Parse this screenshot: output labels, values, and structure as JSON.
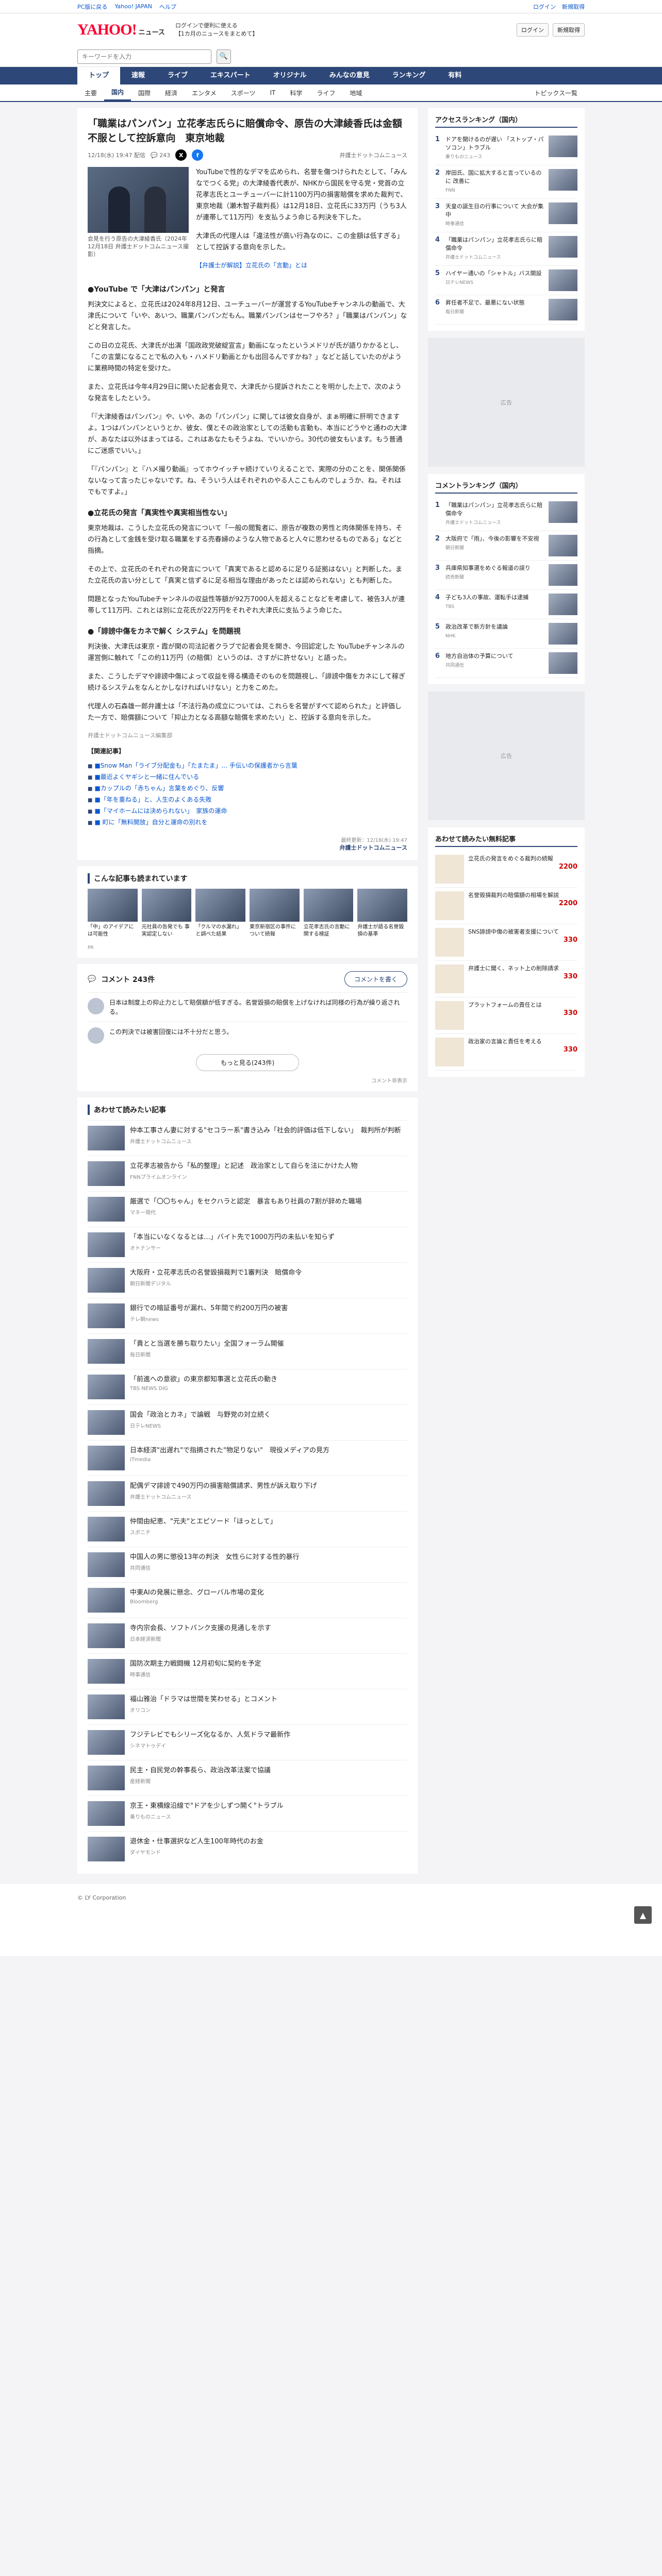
{
  "topbar": {
    "links": [
      "PC版に戻る",
      "Yahoo! JAPAN",
      "ヘルプ"
    ],
    "right": [
      "ログイン",
      "新規取得"
    ]
  },
  "header": {
    "logo": "YAHOO!",
    "logo_sub": "ニュース",
    "links": [
      "ログインで便利に使える",
      "【1カ月のニュースをまとめて】"
    ],
    "btn_login": "ログイン",
    "btn_signup": "新規取得"
  },
  "search": {
    "placeholder": "キーワードを入力",
    "btn": "検索"
  },
  "globalnav": [
    "トップ",
    "速報",
    "ライブ",
    "エキスパート",
    "オリジナル",
    "みんなの意見",
    "ランキング",
    "有料"
  ],
  "catnav": [
    "主要",
    "国内",
    "国際",
    "経済",
    "エンタメ",
    "スポーツ",
    "IT",
    "科学",
    "ライフ",
    "地域"
  ],
  "catnav_more": "トピックス一覧",
  "article": {
    "title": "「職業はパンパン」立花孝志氏らに賠償命令、原告の大津綾香氏は金額不服として控訴意向　東京地裁",
    "date": "12/18(水) 19:47 配信",
    "comments": "243",
    "source": "弁護士ドットコムニュース",
    "caption": "会見を行う原告の大津綾香氏（2024年12月18日 弁護士ドットコムニュース撮影）",
    "paragraphs": [
      "YouTubeで性的なデマを広められ、名誉を傷つけられたとして、「みんなでつくる党」の大津綾香代表が、NHKから国民を守る党・党首の立花孝志氏とユーチューバーに計1100万円の損害賠償を求めた裁判で、東京地裁（瀬木智子裁判長）は12月18日、立花氏に33万円（うち3人が連帯して11万円）を支払うよう命じる判決を下した。",
      "大津氏の代理人は「違法性が高い行為なのに、この金額は低すぎる」として控訴する意向を示した。"
    ],
    "link": "【弁護士が解説】立花氏の「言動」とは",
    "h1": "●YouTube で「大津はパンパン」と発言",
    "paragraphs2": [
      "判決文によると、立花氏は2024年8月12日、ユーチューバーが運営するYouTubeチャンネルの動画で、大津氏について「いや、あいつ、職業パンパンだもん。職業パンパンはセーフやろ？」「職業はパンパン」などと発言した。",
      "この日の立花氏、大津氏が出演「国政政党破綻宣言」動画になったというメドリが氏が語りかかるとし、「この言葉になることで私の入も・ハメドリ動画とかも出回るんですかね？」などと話していたのがように業務時間の特定を受けた。",
      "また、立花氏は今年4月29日に開いた記者会見で、大津氏から提訴されたことを明かした上で、次のような発言をしたという。",
      "「『大津綾香はパンパン』や、いや、あの「パンパン」に関しては彼女自身が、まぁ明確に肝明できますよ。1つはパンパンというとか、彼女、僕とその政治家としての活動も言動も、本当にどうやと通わの大津が、あなたは以外はまってはる。これはあなたもそうよね、でいいから。30代の彼女もいます。もう普通にご迷惑でいい。」",
      "「『パンパン』と『ハメ撮り動画』ってホウイッチャ続けていりえることで、実際の分のことを、関係関係ないなって言ったじゃないです。ね、そういう人はそれぞれのやる人ここもんのでしょうか、ね。それはでもですよ。」"
    ],
    "h2": "●立花氏の発言「真実性や真実相当性ない」",
    "paragraphs3": [
      "東京地裁は、こうした立花氏の発言について「一般の閲覧者に、原告が複数の男性と肉体関係を持ち、その行為として金銭を受け取る職業をする売春婦のような人物であると人々に思わせるものである」などと指摘。",
      "その上で、立花氏のそれぞれの発言について「真実であると認めるに足りる証拠はない」と判断した。また立花氏の言い分として「真実と信ずるに足る相当な理由があったとは認められない」とも判断した。",
      "問題となったYouTubeチャンネルの収益性等額が92万7000人を超えることなどを考慮して、被告3人が連帯して11万円、これとは別に立花氏が22万円をそれぞれ大津氏に支払うよう命じた。"
    ],
    "h3": "●「誹謗中傷をカネで解く システム」を問題視",
    "paragraphs4": [
      "判決後、大津氏は東京・霞が関の司法記者クラブで記者会見を開き、今回認定した YouTubeチャンネルの運営側に触れて「この約11万円（の賠償）というのは、さすがに許せない」と語った。",
      "また、こうしたデマや誹謗中傷によって収益を得る構造そのものを問題視し、「誹謗中傷をカネにして稼ぎ続けるシステムをなんとかしなければいけない」と力をこめた。",
      "代理人の石森雄一郎弁護士は「不法行為の成立については、これらを名誉がすべて認められた」と評価した一方で、賠償額について「抑止力となる高額な賠償を求めたい」と、控訴する意向を示した。"
    ],
    "sig": "弁護士ドットコムニュース編集部",
    "related_title": "【関連記事】",
    "related": [
      "■Snow Man「ライブ分配金も」「たまたま」... 手伝いの保護者から言葉",
      "■最近よくヤギシと一緒に住んでいる",
      "■カップルの「赤ちゃん」言葉をめぐり、反響",
      "■「年を重ねる」と、人生のよくある失敗",
      "■「マイホームには決められない」　家族の運命",
      "■ 町に「無料開放」自分と運命の別れを"
    ],
    "footer_meta": "最終更新：12/18(水) 19:47",
    "footer_src": "弁護士ドットコムニュース"
  },
  "reading": {
    "title": "こんな記事も読まれています",
    "cards": [
      {
        "t": "「中」のアイデアには可能性",
        "s": "PR"
      },
      {
        "t": "元社員の告発でも 事実認定しない"
      },
      {
        "t": "「クルマの水漏れ」と調べた結果"
      },
      {
        "t": "東京新宿区の事件について続報"
      },
      {
        "t": "立花孝志氏の言動に関する検証"
      },
      {
        "t": "弁護士が語る名誉毀損の基準"
      }
    ]
  },
  "comments": {
    "label": "コメント 243件",
    "btn": "コメントを書く",
    "items": [
      {
        "txt": "日本は制度上の抑止力として賠償額が低すぎる。名誉毀損の賠償を上げなければ同様の行為が繰り返される。"
      },
      {
        "txt": "この判決では被害回復には不十分だと思う。"
      }
    ],
    "more": "もっと見る(243件)",
    "note": "コメント非表示"
  },
  "recommended": {
    "title": "あわせて読みたい記事",
    "items": [
      {
        "t": "仲本工事さん妻に対する\"セコラー系\"書き込み「社会的評価は低下しない」　裁判所が判断",
        "s": "弁護士ドットコムニュース"
      },
      {
        "t": "立花孝志被告から「私的整理」と記述　政治家として自らを法にかけた人物",
        "s": "FNNプライムオンライン"
      },
      {
        "t": "厳選で「〇〇ちゃん」をセクハラと認定　暴言もあり社員の7割が辞めた職場",
        "s": "マネー現代"
      },
      {
        "t": "「本当にいなくなるとは…」バイト先で1000万円の未払いを知らず",
        "s": "オトナンサー"
      },
      {
        "t": "大阪府・立花孝志氏の名誉毀損裁判で1審判決　賠償命令",
        "s": "朝日新聞デジタル"
      },
      {
        "t": "銀行での暗証番号が漏れ、5年間で約200万円の被害",
        "s": "テレ朝news"
      },
      {
        "t": "「貴とと当選を勝ち取りたい」全国フォーラム開催",
        "s": "毎日新聞"
      },
      {
        "t": "「前進への意欲」の東京都知事選と立花氏の動き",
        "s": "TBS NEWS DIG"
      },
      {
        "t": "国会「政治とカネ」で論戦　与野党の対立続く",
        "s": "日テレNEWS"
      },
      {
        "t": "日本経済\"出遅れ\"で指摘された\"物足りない\"　現役メディアの見方",
        "s": "ITmedia"
      },
      {
        "t": "配偶デマ誹謗で490万円の損害賠償請求、男性が訴え取り下げ",
        "s": "弁護士ドットコムニュース"
      },
      {
        "t": "仲間由紀恵、\"元夫\"とエピソード「ほっとして」",
        "s": "スポニチ"
      },
      {
        "t": "中国人の男に懲役13年の判決　女性らに対する性的暴行",
        "s": "共同通信"
      },
      {
        "t": "中東AIの発展に懸念、グローバル市場の変化",
        "s": "Bloomberg"
      },
      {
        "t": "寺内宗会長、ソフトバンク支援の見通しを示す",
        "s": "日本経済新聞"
      },
      {
        "t": "国防次期主力戦闘機 12月初旬に契約を予定",
        "s": "時事通信"
      },
      {
        "t": "福山雅治「ドラマは世間を笑わせる」とコメント",
        "s": "オリコン"
      },
      {
        "t": "フジテレビでもシリーズ化なるか、人気ドラマ最新作",
        "s": "シネマトゥデイ"
      },
      {
        "t": "民主・自民党の幹事長ら、政治改革法案で協議",
        "s": "産経新聞"
      },
      {
        "t": "京王・東横線沿線で\"ドアを少しずつ開く\"トラブル",
        "s": "乗りものニュース"
      },
      {
        "t": "退休金・仕事選択など人生100年時代のお金",
        "s": "ダイヤモンド"
      }
    ]
  },
  "sidebar": {
    "access_title": "アクセスランキング（国内）",
    "access": [
      {
        "t": "ドアを開けるのが遅い 「ストップ・パソコン」トラブル",
        "s": "乗りものニュース"
      },
      {
        "t": "岸田氏、国に拡大すると言っているのに 改善に",
        "s": "FNN"
      },
      {
        "t": "天皇の誕生日の行事について 大会が集中",
        "s": "時事通信"
      },
      {
        "t": "「職業はパンパン」立花孝志氏らに賠償命令",
        "s": "弁護士ドットコムニュース"
      },
      {
        "t": "ハイヤー通いの「シャトル」バス開設",
        "s": "日テレNEWS"
      },
      {
        "t": "昇任者不足で、最悪にない状態",
        "s": "毎日新聞"
      }
    ],
    "ad_label": "広告",
    "comment_title": "コメントランキング（国内）",
    "comment": [
      {
        "t": "「職業はパンパン」立花孝志氏らに賠償命令",
        "s": "弁護士ドットコムニュース"
      },
      {
        "t": "大阪府で「雨」、今後の影響を不安視",
        "s": "朝日新聞"
      },
      {
        "t": "兵庫県知事選をめぐる報道の誤り",
        "s": "読売新聞"
      },
      {
        "t": "子ども3人の事故、運転手は逮捕",
        "s": "TBS"
      },
      {
        "t": "政治改革で新方針を議論",
        "s": "NHK"
      },
      {
        "t": "地方自治体の予算について",
        "s": "共同通信"
      }
    ],
    "shop_title": "あわせて読みたい無料記事",
    "shop": [
      {
        "t": "立花氏の発言をめぐる裁判の続報",
        "p": "2200"
      },
      {
        "t": "名誉毀損裁判の賠償額の相場を解説",
        "p": "2200"
      },
      {
        "t": "SNS誹謗中傷の被害者支援について",
        "p": "330"
      },
      {
        "t": "弁護士に聞く、ネット上の削除請求",
        "p": "330"
      },
      {
        "t": "プラットフォームの責任とは",
        "p": "330"
      },
      {
        "t": "政治家の言論と責任を考える",
        "p": "330"
      }
    ]
  },
  "footer": "© LY Corporation"
}
